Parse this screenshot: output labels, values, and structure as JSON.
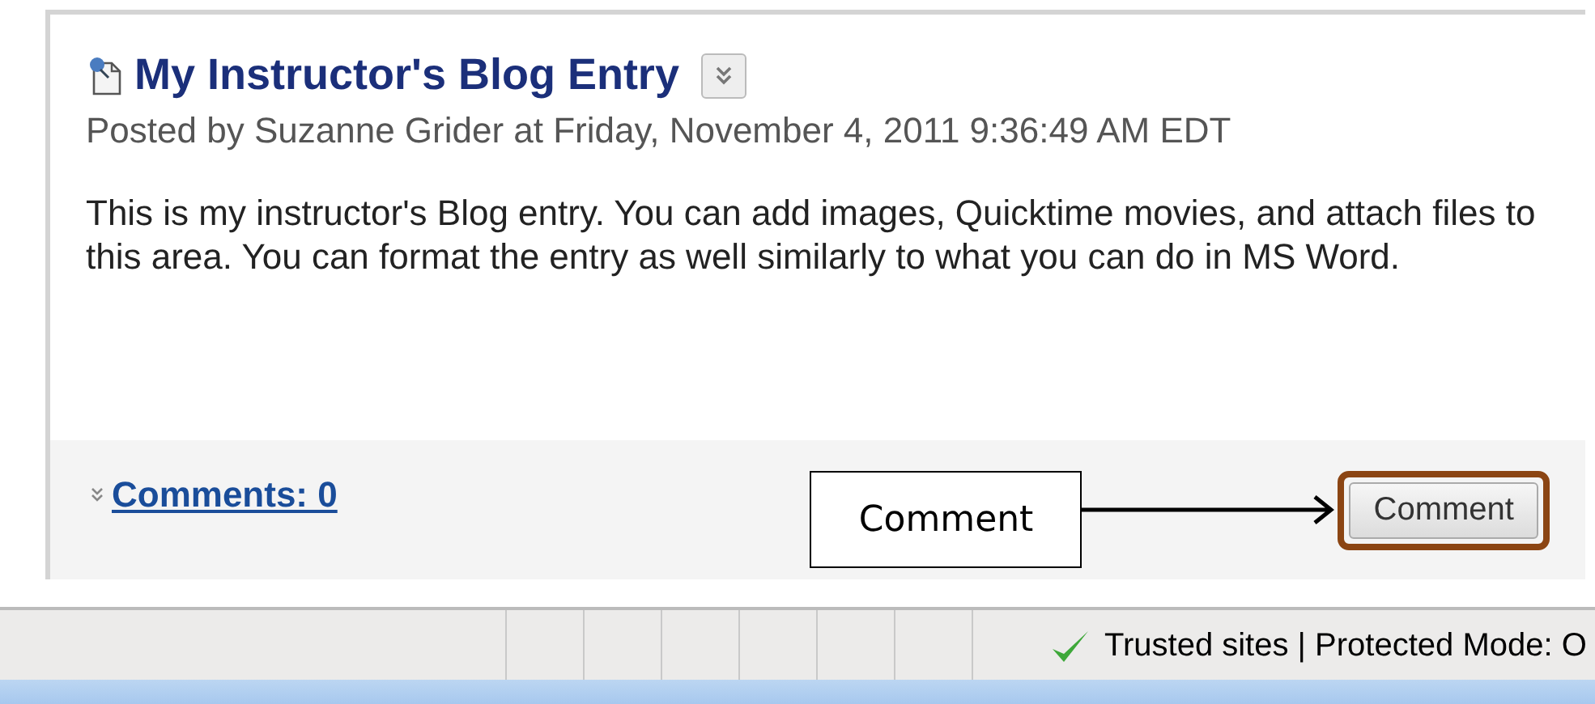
{
  "entry": {
    "title": "My Instructor's Blog Entry",
    "byline": "Posted by Suzanne Grider at Friday, November 4, 2011 9:36:49 AM EDT",
    "body": "This is my instructor's Blog entry. You can add images, Quicktime movies, and attach files to this area. You can format the entry as well similarly to what you can do in MS Word."
  },
  "footer": {
    "comments_link": "Comments: 0",
    "comment_button": "Comment"
  },
  "callout": {
    "label": "Comment"
  },
  "status_bar": {
    "zone": "Trusted sites | Protected Mode: O"
  }
}
